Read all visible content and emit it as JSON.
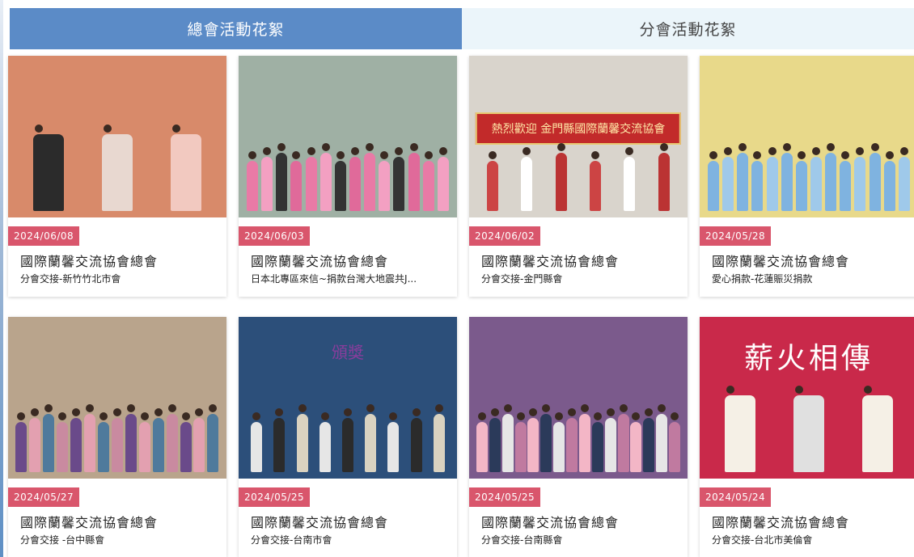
{
  "tabs": [
    {
      "label": "總會活動花絮"
    },
    {
      "label": "分會活動花絮"
    }
  ],
  "cards": [
    {
      "date": "2024/06/08",
      "title": "國際蘭馨交流協會總會",
      "subtitle": "分會交接-新竹竹北市會",
      "bg": "#d88a6a",
      "scene": "flag"
    },
    {
      "date": "2024/06/03",
      "title": "國際蘭馨交流協會總會",
      "subtitle": "日本北專區來信~捐款台灣大地震共J...",
      "bg": "#9fb0a4",
      "scene": "outdoor"
    },
    {
      "date": "2024/06/02",
      "title": "國際蘭馨交流協會總會",
      "subtitle": "分會交接-金門縣會",
      "bg": "#d9d4cc",
      "scene": "banner",
      "banner_text": "熱烈歡迎 金門縣國際蘭馨交流協會"
    },
    {
      "date": "2024/05/28",
      "title": "國際蘭馨交流協會總會",
      "subtitle": "愛心捐款-花蓮賑災捐款",
      "bg": "#e8d98a",
      "scene": "meeting"
    },
    {
      "date": "2024/05/27",
      "title": "國際蘭馨交流協會總會",
      "subtitle": "分會交接 -台中縣會",
      "bg": "#b9a48c",
      "scene": "hall"
    },
    {
      "date": "2024/05/25",
      "title": "國際蘭馨交流協會總會",
      "subtitle": "分會交接-台南市會",
      "bg": "#2c4f7a",
      "scene": "award",
      "banner_text": "頒獎"
    },
    {
      "date": "2024/05/25",
      "title": "國際蘭馨交流協會總會",
      "subtitle": "分會交接-台南縣會",
      "bg": "#7b5a8c",
      "scene": "stage"
    },
    {
      "date": "2024/05/24",
      "title": "國際蘭馨交流協會總會",
      "subtitle": "分會交接-台北市美倫會",
      "bg": "#c9294a",
      "scene": "pink",
      "banner_text": "薪火相傳"
    }
  ],
  "colors": {
    "tab_active": "#5b8bc7",
    "tab_inactive": "#ebf5fa",
    "date_badge": "#d9566c"
  }
}
